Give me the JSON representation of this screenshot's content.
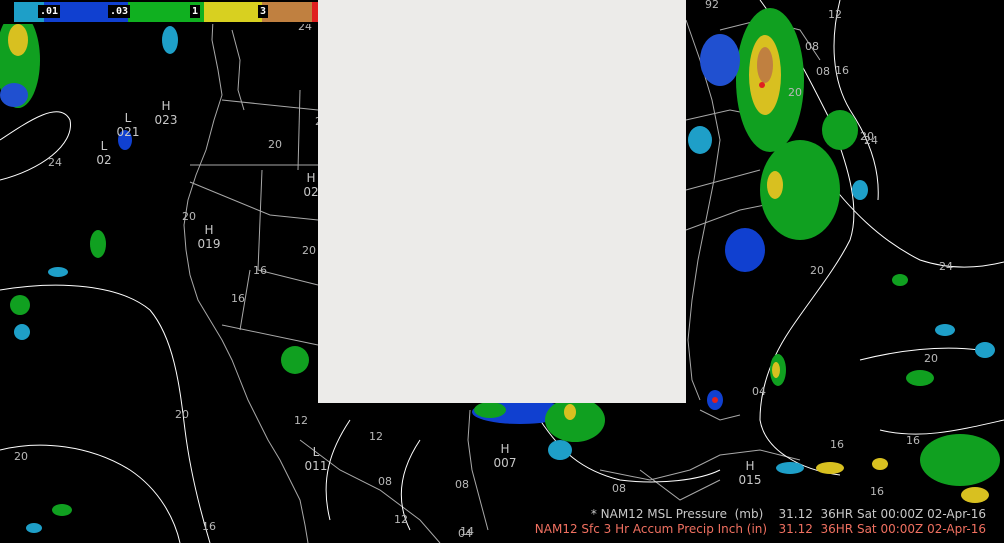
{
  "colorbar": {
    "ticks": [
      ".01",
      ".03",
      "1",
      "3"
    ],
    "colors": [
      "#1e9fc8",
      "#1040d0",
      "#10b020",
      "#d8d020",
      "#c08040",
      "#e02020"
    ]
  },
  "map": {
    "background": "#000000",
    "contour_color": "#ffffff",
    "pressure_labels": [
      "24",
      "20",
      "20",
      "20",
      "20",
      "16",
      "16",
      "20",
      "20",
      "16",
      "12",
      "12",
      "08",
      "08",
      "08",
      "04",
      "12",
      "16",
      "20",
      "24",
      "20",
      "16",
      "16",
      "08",
      "24",
      "20",
      "20",
      "92",
      "12",
      "08",
      "16",
      "24",
      "14",
      "04",
      "16"
    ],
    "systems": [
      {
        "type": "H",
        "value": "023"
      },
      {
        "type": "L",
        "value": "021"
      },
      {
        "type": "L",
        "value": "02"
      },
      {
        "type": "H",
        "value": "019"
      },
      {
        "type": "H",
        "value": "02"
      },
      {
        "type": "L",
        "value": "011"
      },
      {
        "type": "H",
        "value": "007"
      },
      {
        "type": "H",
        "value": "015"
      }
    ]
  },
  "panel": {
    "color": "#ecebe9"
  },
  "legend": {
    "line1": "* NAM12 MSL Pressure  (mb)    31.12  36HR Sat 00:00Z 02-Apr-16",
    "line2": "NAM12 Sfc 3 Hr Accum Precip Inch (in)   31.12  36HR Sat 00:00Z 02-Apr-16",
    "line1_color": "#c8c8c8",
    "line2_color": "#f07060"
  }
}
